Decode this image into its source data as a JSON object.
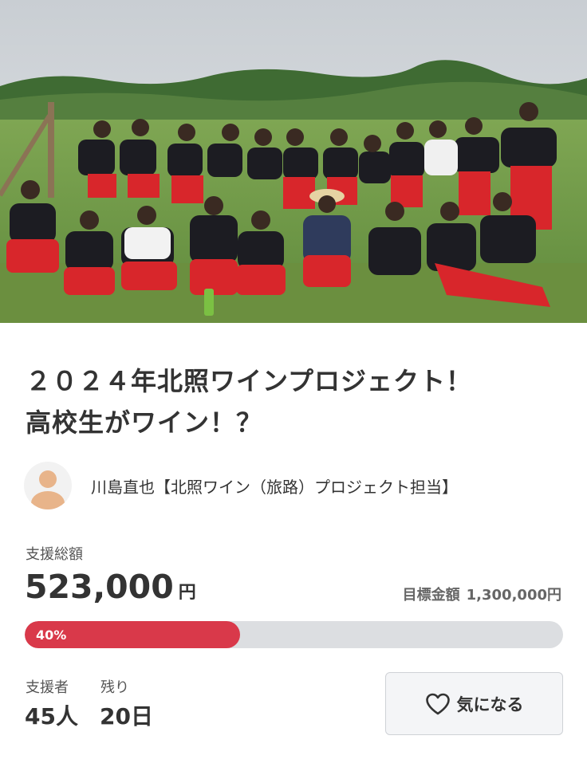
{
  "project": {
    "title_line1": "２０２４年北照ワインプロジェクト！",
    "title_line2": "高校生がワイン！？"
  },
  "owner": {
    "name": "川島直也【北照ワイン（旅路）プロジェクト担当】",
    "avatar_icon": "user-silhouette-icon"
  },
  "funding": {
    "total_label": "支援総額",
    "total_amount": "523,000",
    "currency_unit": "円",
    "goal_label": "目標金額",
    "goal_amount": "1,300,000円",
    "progress_percent_text": "40%",
    "progress_percent": 40
  },
  "stats": {
    "supporters_label": "支援者",
    "supporters_value": "45人",
    "remaining_label": "残り",
    "remaining_value": "20日"
  },
  "favorite_button": {
    "label": "気になる",
    "icon": "heart-icon"
  },
  "colors": {
    "accent": "#d9394a",
    "track": "#dcdee1",
    "text": "#333333"
  }
}
